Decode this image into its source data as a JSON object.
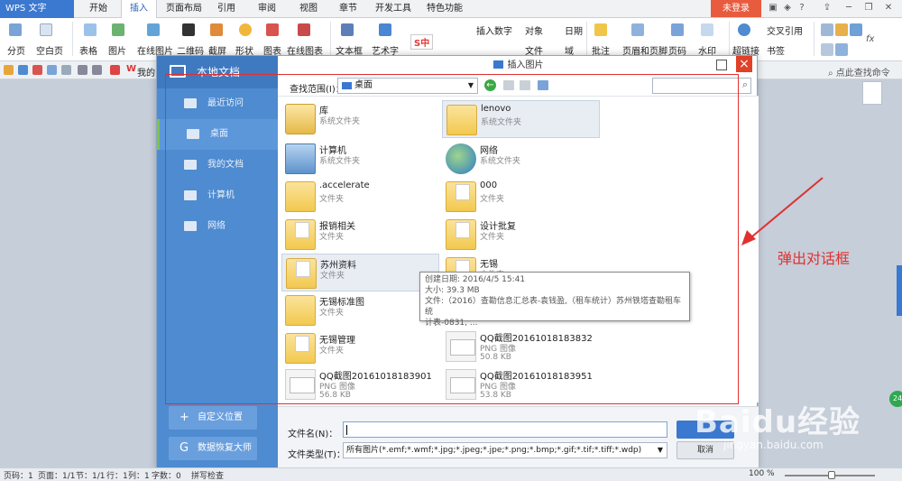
{
  "app": {
    "name": "WPS 文字"
  },
  "tabs": [
    "开始",
    "插入",
    "页面布局",
    "引用",
    "审阅",
    "视图",
    "章节",
    "开发工具",
    "特色功能"
  ],
  "active_tab": "插入",
  "login_label": "未登录",
  "ribbon": {
    "items": [
      "分页",
      "空白页",
      "表格",
      "图片",
      "在线图片",
      "二维码",
      "截屏",
      "形状",
      "图表",
      "在线图表",
      "文本框",
      "艺术字",
      "插入数字",
      "对象",
      "日期",
      "文件",
      "域",
      "批注",
      "页眉和页脚",
      "页码",
      "水印",
      "超链接",
      "交叉引用",
      "书签"
    ],
    "ime_label": "S中",
    "fmt_label": "fx"
  },
  "qat": {
    "doc_tab": "我的",
    "search_label": "点此查找命令"
  },
  "dialog": {
    "title": "插入图片",
    "close_glyph": "×",
    "sidebar": {
      "header": "本地文档",
      "items": [
        "最近访问",
        "桌面",
        "我的文档",
        "计算机",
        "网络"
      ],
      "selected": "桌面",
      "custom_location": "自定义位置",
      "recovery": "数据恢复大师"
    },
    "look_in_label": "查找范围(I)：",
    "look_in_value": "桌面",
    "files": [
      {
        "name": "库",
        "type": "系统文件夹"
      },
      {
        "name": "lenovo",
        "type": "系统文件夹"
      },
      {
        "name": "计算机",
        "type": "系统文件夹"
      },
      {
        "name": "网络",
        "type": "系统文件夹"
      },
      {
        "name": ".accelerate",
        "type": "文件夹"
      },
      {
        "name": "000",
        "type": "文件夹"
      },
      {
        "name": "报销相关",
        "type": "文件夹"
      },
      {
        "name": "设计批复",
        "type": "文件夹"
      },
      {
        "name": "苏州资料",
        "type": "文件夹"
      },
      {
        "name": "无锡",
        "type": "文件夹"
      },
      {
        "name": "无锡标准图",
        "type": "文件夹"
      },
      {
        "name": "无锡管理",
        "type": "文件夹"
      },
      {
        "name": "QQ截图20161018183832",
        "type": "PNG 图像",
        "size": "50.8 KB"
      },
      {
        "name": "QQ截图20161018183901",
        "type": "PNG 图像",
        "size": "56.8 KB"
      },
      {
        "name": "QQ截图20161018183951",
        "type": "PNG 图像",
        "size": "53.8 KB"
      }
    ],
    "tooltip": {
      "line1": "创建日期: 2016/4/5 15:41",
      "line2": "大小: 39.3 MB",
      "line3": "文件:（2016）查勘信息汇总表-袁钱盈,（租车统计）苏州铁塔查勘租车统",
      "line4": "计表-0831, ..."
    },
    "filename_label": "文件名(N)：",
    "filename_value": "",
    "filetype_label": "文件类型(T)：",
    "filetype_value": "所有图片(*.emf;*.wmf;*.jpg;*.jpeg;*.jpe;*.png;*.bmp;*.gif;*.tif;*.tiff;*.wdp)",
    "cancel_label": "取消"
  },
  "annotation": {
    "text": "弹出对话框",
    "color": "#e13030"
  },
  "statusbar": {
    "page_code": "页码：1",
    "pages": "页面：1/1",
    "section": "节：1/1",
    "row": "行：1",
    "col": "列：1",
    "chars": "字数：0",
    "spell": "拼写检查",
    "zoom": "100 %"
  },
  "watermark": {
    "text": "Baidu经验",
    "url": "jingyan.baidu.com"
  },
  "colors": {
    "accent": "#3b78cf",
    "sidebar": "#4e8bd0",
    "login": "#e85b3e"
  }
}
